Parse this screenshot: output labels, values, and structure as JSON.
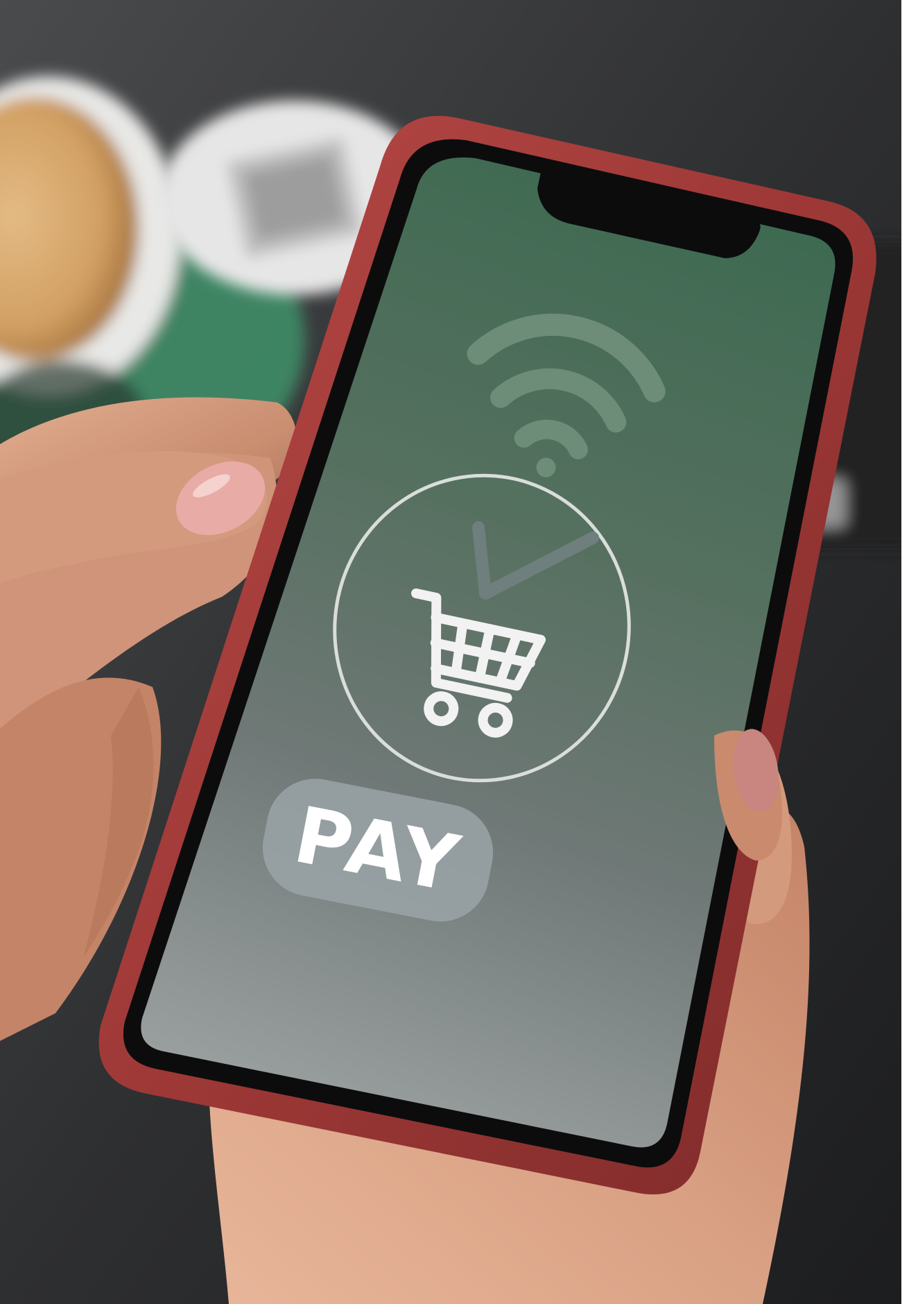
{
  "scene": {
    "pay_button": {
      "label": "PAY"
    },
    "icons": [
      "wifi-icon",
      "checkmark-icon",
      "shopping-cart-icon"
    ],
    "colors": {
      "table": "#2c2c2e",
      "phone_case": "#a53c3c",
      "screen_top": "#3d6650",
      "screen_bottom": "#8f9696",
      "pay_button": "#9aa3a7",
      "skin": "#d89e82",
      "nail": "#e6a6a2",
      "coffee": "#d8a96e",
      "saucer": "#3f8c66"
    }
  }
}
